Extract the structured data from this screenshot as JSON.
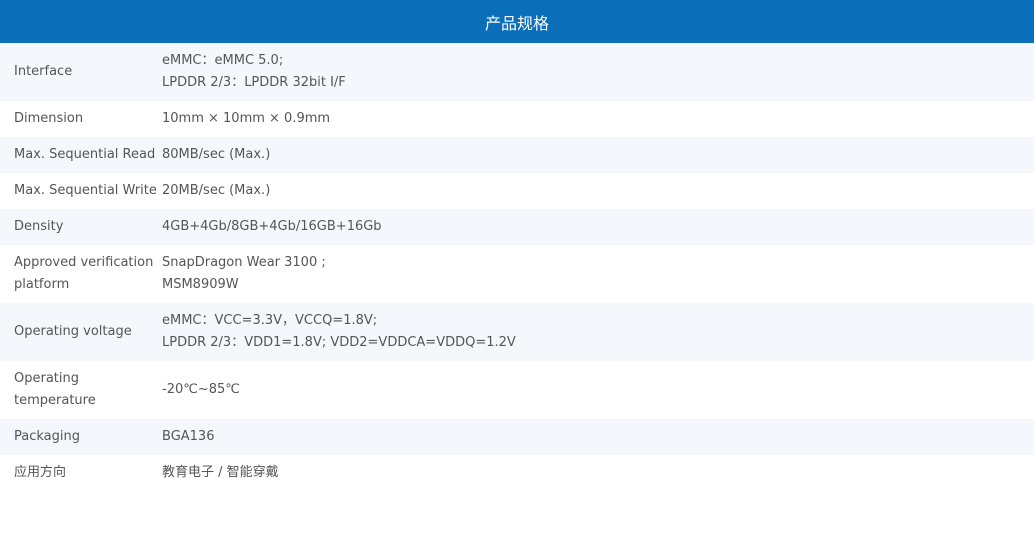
{
  "title": "产品规格",
  "colors": {
    "header_bg": "#0a6eb9",
    "header_text": "#ffffff",
    "row_alt_bg": "#f4f8fc",
    "text": "#555555"
  },
  "rows": [
    {
      "label": "Interface",
      "lines": [
        "eMMC：eMMC 5.0;",
        "LPDDR 2/3：LPDDR 32bit I/F"
      ]
    },
    {
      "label": "Dimension",
      "lines": [
        "10mm × 10mm × 0.9mm"
      ]
    },
    {
      "label": "Max. Sequential Read",
      "lines": [
        "80MB/sec (Max.)"
      ]
    },
    {
      "label": "Max. Sequential Write",
      "lines": [
        "20MB/sec (Max.)"
      ]
    },
    {
      "label": "Density",
      "lines": [
        "4GB+4Gb/8GB+4Gb/16GB+16Gb"
      ]
    },
    {
      "label": "Approved verification platform",
      "lines": [
        "SnapDragon Wear 3100 ;",
        "MSM8909W"
      ]
    },
    {
      "label": "Operating voltage",
      "lines": [
        "eMMC：VCC=3.3V，VCCQ=1.8V;",
        "LPDDR 2/3：VDD1=1.8V; VDD2=VDDCA=VDDQ=1.2V"
      ]
    },
    {
      "label": "Operating temperature",
      "lines": [
        "-20℃~85℃"
      ]
    },
    {
      "label": "Packaging",
      "lines": [
        "BGA136"
      ]
    },
    {
      "label": "应用方向",
      "lines": [
        "教育电子 / 智能穿戴"
      ]
    }
  ]
}
